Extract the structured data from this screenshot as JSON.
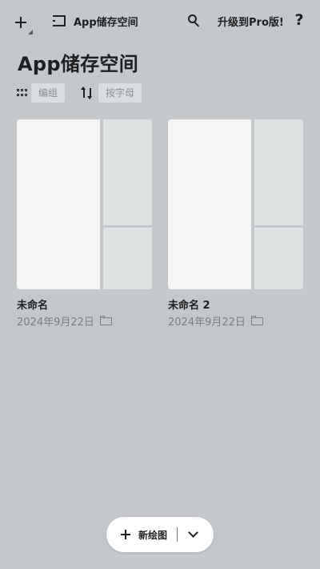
{
  "header": {
    "storage_label": "App储存空间",
    "upgrade_label": "升级到Pro版!",
    "help_label": "?"
  },
  "page": {
    "title": "App储存空间"
  },
  "toolbar": {
    "edit_label": "编组",
    "sort_label": "按字母"
  },
  "drawings": [
    {
      "name": "未命名",
      "date": "2024年9月22日"
    },
    {
      "name": "未命名 2",
      "date": "2024年9月22日"
    }
  ],
  "new_drawing": {
    "label": "新绘图"
  },
  "icons": {
    "add": "plus-icon",
    "panel": "sidebar-panel-icon",
    "search": "search-icon",
    "grid": "grid-icon",
    "sort": "sort-arrows-icon",
    "folder": "folder-icon",
    "expand": "chevron-down-icon"
  },
  "colors": {
    "background": "#c4c8cb",
    "card_main": "#f5f5f5",
    "card_side": "#dfe2e3",
    "text": "#1e1f20",
    "muted_text": "#7a7e81",
    "pill": "#ffffff"
  }
}
